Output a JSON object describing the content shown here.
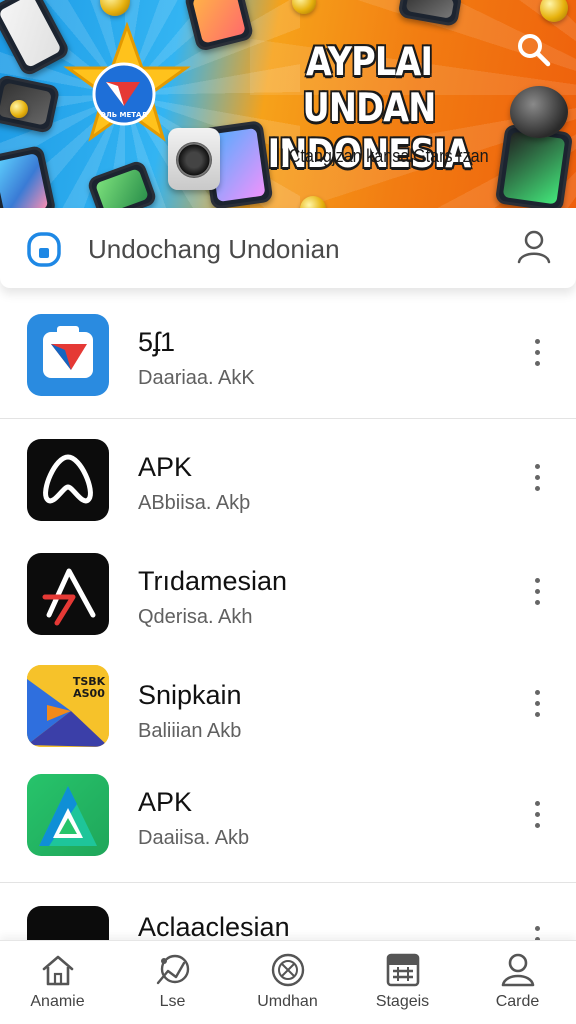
{
  "banner": {
    "title_line1": "AYPLAI UNDAN",
    "title_line2": "INDONESIA",
    "subtitle": "| Ctangjzan kansalGtars rzan",
    "badge_text": "ЭЛЬ МЕТАЛ"
  },
  "search": {
    "text": "Undochang Undonian"
  },
  "apps": [
    {
      "name": "5ʄ1",
      "subtitle": "Daariaa. AkK"
    },
    {
      "name": "APK",
      "subtitle": "ABbiisa. Akþ"
    },
    {
      "name": "Trıdamesian",
      "subtitle": "Qderisa. Akh"
    },
    {
      "name": "Snipkain",
      "subtitle": "Baliiian Akb",
      "icon_text": "TSBK\nAS00"
    },
    {
      "name": "APK",
      "subtitle": "Daaiisa. Akb"
    },
    {
      "name": "Aclaaclesian",
      "subtitle": ""
    }
  ],
  "nav": [
    {
      "label": "Anamie",
      "icon": "home-icon"
    },
    {
      "label": "Lse",
      "icon": "compass-icon"
    },
    {
      "label": "Umdhan",
      "icon": "globe-icon"
    },
    {
      "label": "Stageis",
      "icon": "news-icon"
    },
    {
      "label": "Carde",
      "icon": "user-icon"
    }
  ],
  "colors": {
    "banner_blue": "#1d9be6",
    "banner_orange": "#f27c12",
    "accent": "#1e88e5",
    "green": "#2ecc71"
  }
}
